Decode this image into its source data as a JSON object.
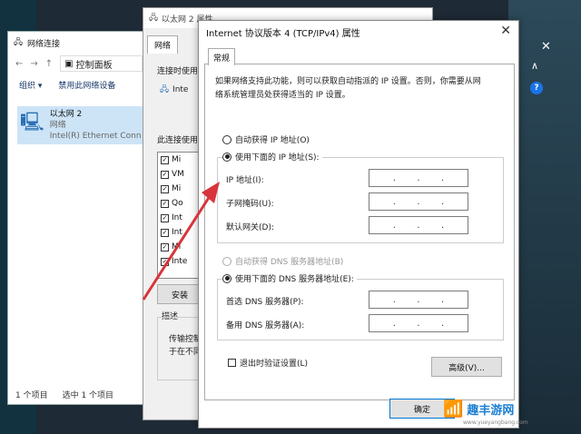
{
  "win1": {
    "title": "网络连接",
    "address": "控制面板",
    "cmd_organize": "组织 ▾",
    "cmd_disable": "禁用此网络设备",
    "item": {
      "name": "以太网 2",
      "type": "网络",
      "adapter": "Intel(R) Ethernet Conn"
    },
    "status_count": "1 个项目",
    "status_selected": "选中 1 个项目"
  },
  "win2": {
    "title": "以太网 2 属性",
    "tab": "网络",
    "connect_using_label": "连接时使用",
    "adapter_short": "Inte",
    "uses_items_label": "此连接使用",
    "list": [
      {
        "label": "Mi",
        "checked": true
      },
      {
        "label": "VM",
        "checked": true
      },
      {
        "label": "Mi",
        "checked": true
      },
      {
        "label": "Qo",
        "checked": true
      },
      {
        "label": "Int",
        "checked": true
      },
      {
        "label": "Int",
        "checked": true
      },
      {
        "label": "Mi",
        "checked": true
      },
      {
        "label": "Inte",
        "checked": true
      }
    ],
    "install_btn": "安装",
    "desc_label": "描述",
    "desc_text_1": "传输控制",
    "desc_text_2": "于在不同",
    "ok_fragment": "确"
  },
  "dialog": {
    "title": "Internet 协议版本 4 (TCP/IPv4) 属性",
    "tab": "常规",
    "intro_line1": "如果网络支持此功能，则可以获取自动指派的 IP 设置。否则，你需要从网",
    "intro_line2": "络系统管理员处获得适当的 IP 设置。",
    "auto_ip": "自动获得 IP 地址(O)",
    "use_ip": "使用下面的 IP 地址(S):",
    "ip_label": "IP 地址(I):",
    "mask_label": "子网掩码(U):",
    "gateway_label": "默认网关(D):",
    "auto_dns": "自动获得 DNS 服务器地址(B)",
    "use_dns": "使用下面的 DNS 服务器地址(E):",
    "dns1_label": "首选 DNS 服务器(P):",
    "dns2_label": "备用 DNS 服务器(A):",
    "validate_label": "退出时验证设置(L)",
    "advanced_btn": "高级(V)...",
    "ok_btn": "确定",
    "ip_dot": "."
  },
  "right": {
    "help": "?"
  },
  "watermark": {
    "brand": "趣丰游网",
    "url": "www.yueyangbang.com"
  },
  "colors": {
    "accent": "#0078d7",
    "arrow": "#d8343b",
    "selection": "#cde4f7"
  },
  "icons": [
    "network-icon",
    "computer-icon",
    "close-icon",
    "help-icon",
    "checkbox-icon"
  ]
}
